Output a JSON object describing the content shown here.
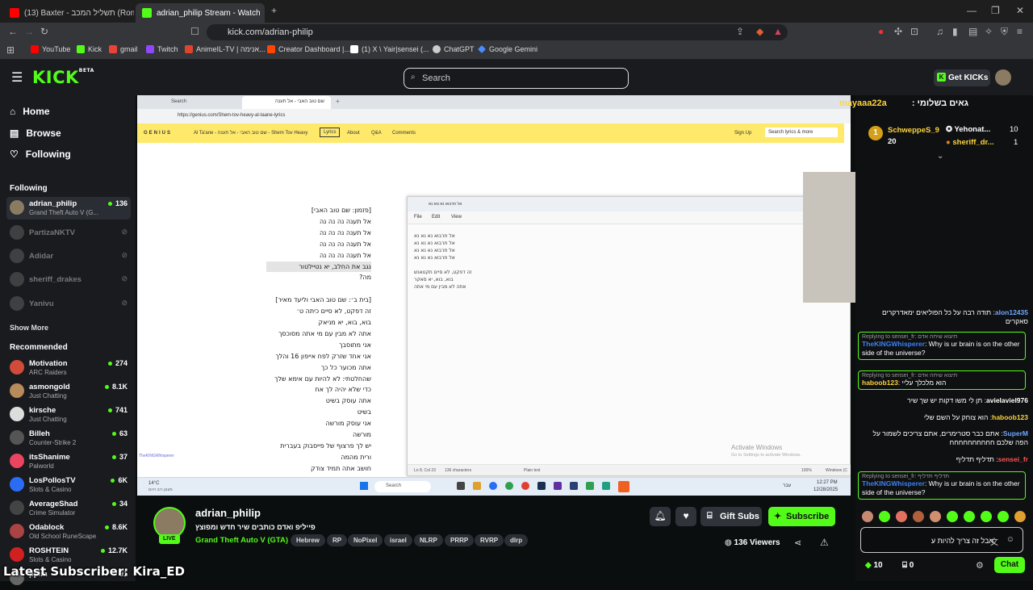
{
  "browser": {
    "tabs": [
      {
        "label": "(13) Baxter - תשליל המכב (Ronengg D",
        "fav_color": "#ff0000"
      },
      {
        "label": "adrian_philip Stream - Watch",
        "fav_color": "#53fc18"
      }
    ],
    "url": "kick.com/adrian-philip",
    "bookmarks": [
      {
        "label": "YouTube",
        "color": "#ff0000"
      },
      {
        "label": "Kick",
        "color": "#53fc18"
      },
      {
        "label": "gmail",
        "color": "#ea4335"
      },
      {
        "label": "Twitch",
        "color": "#9146ff"
      },
      {
        "label": "AnimeIL-TV | אנימה...",
        "color": "#e0442d"
      },
      {
        "label": "Creator Dashboard |...",
        "color": "#ff4500"
      },
      {
        "label": "(1) X \\ Yair|sensei (...",
        "color": "#ffffff"
      },
      {
        "label": "ChatGPT",
        "color": "#cccccc"
      },
      {
        "label": "Google Gemini",
        "color": "#4a8cff"
      }
    ]
  },
  "header": {
    "logo": "KICK",
    "logo_sup": "BETA",
    "search_placeholder": "Search",
    "get_kicks": "Get KICKs"
  },
  "sidebar": {
    "nav": [
      {
        "label": "Home",
        "icon": "home-icon"
      },
      {
        "label": "Browse",
        "icon": "browse-icon"
      },
      {
        "label": "Following",
        "icon": "heart-icon"
      }
    ],
    "following_title": "Following",
    "following": [
      {
        "name": "adrian_philip",
        "game": "Grand Theft Auto V (G...",
        "viewers": "136",
        "live": true,
        "color": "#8a7b62"
      },
      {
        "name": "PartizaNKTV",
        "live": false,
        "color": "#777"
      },
      {
        "name": "Adidar",
        "live": false,
        "color": "#777"
      },
      {
        "name": "sheriff_drakes",
        "live": false,
        "color": "#777"
      },
      {
        "name": "Yanivu",
        "live": false,
        "color": "#777"
      }
    ],
    "show_more": "Show More",
    "recommended_title": "Recommended",
    "recommended": [
      {
        "name": "Motivation",
        "game": "ARC Raiders",
        "viewers": "274",
        "color": "#d14b3a"
      },
      {
        "name": "asmongold",
        "game": "Just Chatting",
        "viewers": "8.1K",
        "color": "#b98a5a"
      },
      {
        "name": "kirsche",
        "game": "Just Chatting",
        "viewers": "741",
        "color": "#ddd"
      },
      {
        "name": "Billeh",
        "game": "Counter-Strike 2",
        "viewers": "63",
        "color": "#555"
      },
      {
        "name": "itsShanime",
        "game": "Palworld",
        "viewers": "37",
        "color": "#e94560"
      },
      {
        "name": "LosPollosTV",
        "game": "Slots & Casino",
        "viewers": "6K",
        "color": "#2a6df4"
      },
      {
        "name": "AverageShad",
        "game": "Crime Simulator",
        "viewers": "34",
        "color": "#444"
      },
      {
        "name": "Odablock",
        "game": "Old School RuneScape",
        "viewers": "8.6K",
        "color": "#aa4444"
      },
      {
        "name": "ROSHTEIN",
        "game": "Slots & Casino",
        "viewers": "12.7K",
        "color": "#d02020"
      },
      {
        "name": "pplm",
        "game": "",
        "viewers": "91",
        "color": "#666"
      }
    ]
  },
  "video": {
    "site_tabs": [
      "Search",
      "שם טוב האבי - אל תענה"
    ],
    "page_url": "https://genius.com/Shem-tov-heavy-al-taane-lyrics",
    "genius_logo": "GENIUS",
    "song_title": "Al Ta'ane - שם טוב האבי - אל תענה - Shem Tov Heavy",
    "genius_nav": [
      "Lyrics",
      "About",
      "Q&A",
      "Comments"
    ],
    "sign_up": "Sign Up",
    "search_lyrics": "Search lyrics & more",
    "lyrics": [
      "[פזמון: שם טוב האבי]",
      "אל תענה נה נה נה",
      "אל תענה נה נה נה",
      "אל תענה נה נה נה",
      "אל תענה נה נה נה",
      "נגב את החלב, יא נטיילטור",
      "מה?",
      "",
      "[בית ב׳: שם טוב האבי וליעד מאיר]",
      "זה דפקט, לא סיים כיתה ט׳",
      "בוא, בוא, יא מניאק",
      "אתה לא מבין עם מי אתה מסוכסך",
      "אני מתוסבך",
      "אני אחד שזרק לפח אייפון 16 והלך",
      "אתה מכוער כל כך",
      "שהחלטתי: לא להיות עם אימא שלך",
      "כדי שלא יהיה לך אח",
      "אתה עוסק בשיט",
      "בשיט",
      "אני עוסק מורשה",
      "מורשה",
      "יש לך פרצוף של פייסבוק בעברית",
      "ורית מהמה",
      "חושב אתה תמיד צודק"
    ],
    "notepad_tab": "אל תרבוא נא נוא נא",
    "notepad_menu": [
      "File",
      "Edit",
      "View"
    ],
    "notepad_lines": [
      "אל תרבוא נא נא נא",
      "אל תרבוא נא נא נא",
      "אל תרבוא נא נא נא",
      "אל תרבוא נא נא נא",
      "",
      "זה דפקט, לא סיים תקטאנש",
      "בוא, בוא, יא סאקר",
      "אתה לא מבין עם מי אתה"
    ],
    "notepad_status": [
      "Ln 8, Col 23",
      "136 characters",
      "Plain text",
      "100%",
      "Windows (C"
    ],
    "activate_title": "Activate Windows",
    "activate_sub": "Go to Settings to activate Windows.",
    "overlay_sub": "TheKINGWhisperer",
    "clock_time": "12:27 PM",
    "clock_date": "12/28/2025",
    "taskbar_search": "Search",
    "taskbar_lang": "עבר",
    "weather": "14°C",
    "weather_sub": "מעונן רוב היום"
  },
  "stream": {
    "channel": "adrian_philip",
    "title": "פייליפ ואדם כותבים שיר חדש ומפוצץ",
    "game": "Grand Theft Auto V (GTA)",
    "tags": [
      "Hebrew",
      "RP",
      "NoPixel",
      "israel",
      "NLRP",
      "PRRP",
      "RVRP",
      "dlrp"
    ],
    "live": "LIVE",
    "viewers": "136 Viewers",
    "gift_subs": "Gift Subs",
    "subscribe": "Subscribe"
  },
  "chat": {
    "pinned_user": "mayaaa22a",
    "pinned_text": "גאים בשלומי :",
    "leaders": [
      {
        "rank": "1",
        "name": "SchweppeS_9",
        "value": "20"
      },
      {
        "name": "Yehonat...",
        "value": "10"
      },
      {
        "name": "sheriff_dr...",
        "value": "1"
      }
    ],
    "messages": [
      {
        "user": "alon12435",
        "user_color": "#6fa8ff",
        "text": "תודה רבה על כל הפוליאים ימאדרקרים סאקרים"
      },
      {
        "reply_to": "Replying to sensei_fr: תיצוא שיחה אדם",
        "user": "TheKINGWhisperer",
        "user_color": "#3b82f6",
        "text": "Why is ur brain is on the other side of the universe?"
      },
      {
        "reply_to": "Replying to sensei_fr: תיצוא שיחה אדם",
        "user": "haboob123",
        "user_color": "#ffd43b",
        "text": "הוא מלכלך עליי"
      },
      {
        "user": "avielaviel976",
        "user_color": "#ffffff",
        "text": "תן לי משו דקות יש שך שיר"
      },
      {
        "user": "haboob123",
        "user_color": "#ffd43b",
        "text": "הוא צוחק על השם שלי"
      },
      {
        "user": "SuperM",
        "user_color": "#6fa8ff",
        "text": "אתם כבר סטרימרים, אתם צריכים לשמור על הפה שלכם חחחחחחחחחח"
      },
      {
        "user": "sensei_fr",
        "user_color": "#ff5555",
        "text": "תדליף תדליף"
      },
      {
        "reply_to": "Replying to sensei_fr: תדליף תדליף",
        "user": "TheKINGWhisperer",
        "user_color": "#3b82f6",
        "text": "Why is ur brain is on the other side of the universe?"
      }
    ],
    "input_value": "אבל זה צריך להיות ע",
    "kicks_count": "10",
    "gifts_count": "0",
    "send": "Chat"
  },
  "overlay": {
    "latest_subscriber": "Latest Subscriber: Kira_ED"
  },
  "colors": {
    "kick_green": "#53fc18",
    "genius_yellow": "#ffe96b",
    "panel": "#191b1f"
  }
}
